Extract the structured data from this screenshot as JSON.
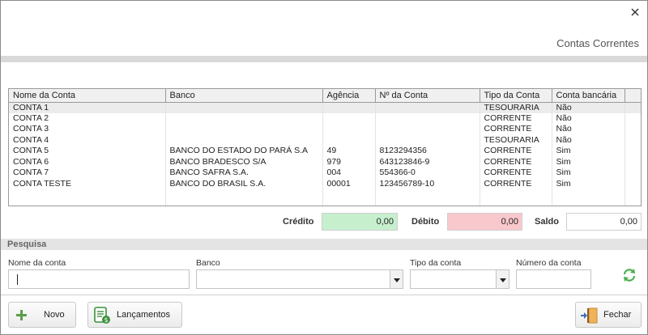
{
  "window": {
    "title": "Contas Correntes"
  },
  "table": {
    "columns": [
      "Nome da Conta",
      "Banco",
      "Agência",
      "Nº da Conta",
      "Tipo da Conta",
      "Conta bancária"
    ],
    "rows": [
      [
        "CONTA 1",
        "",
        "",
        "",
        "TESOURARIA",
        "Não"
      ],
      [
        "CONTA 2",
        "",
        "",
        "",
        "CORRENTE",
        "Não"
      ],
      [
        "CONTA 3",
        "",
        "",
        "",
        "CORRENTE",
        "Não"
      ],
      [
        "CONTA 4",
        "",
        "",
        "",
        "TESOURARIA",
        "Não"
      ],
      [
        "CONTA 5",
        "BANCO DO ESTADO DO PARÁ S.A",
        "49",
        "8123294356",
        "CORRENTE",
        "Sim"
      ],
      [
        "CONTA 6",
        "BANCO BRADESCO S/A",
        "979",
        "643123846-9",
        "CORRENTE",
        "Sim"
      ],
      [
        "CONTA 7",
        "BANCO SAFRA S.A.",
        "004",
        "554366-0",
        "CORRENTE",
        "Sim"
      ],
      [
        "CONTA TESTE",
        "BANCO DO BRASIL S.A.",
        "00001",
        "123456789-10",
        "CORRENTE",
        "Sim"
      ]
    ],
    "selected_row": 0
  },
  "totals": {
    "credito_label": "Crédito",
    "credito_value": "0,00",
    "debito_label": "Débito",
    "debito_value": "0,00",
    "saldo_label": "Saldo",
    "saldo_value": "0,00"
  },
  "colors": {
    "credito_bg": "#c6efce",
    "debito_bg": "#f8c8cc",
    "refresh": "#4caf50",
    "add": "#5a9e4b"
  },
  "search": {
    "header": "Pesquisa",
    "nome_label": "Nome da conta",
    "nome_value": "",
    "banco_label": "Banco",
    "banco_value": "",
    "tipo_label": "Tipo da conta",
    "tipo_value": "",
    "numero_label": "Número da conta",
    "numero_value": ""
  },
  "footer": {
    "novo": "Novo",
    "lancamentos": "Lançamentos",
    "fechar": "Fechar"
  }
}
